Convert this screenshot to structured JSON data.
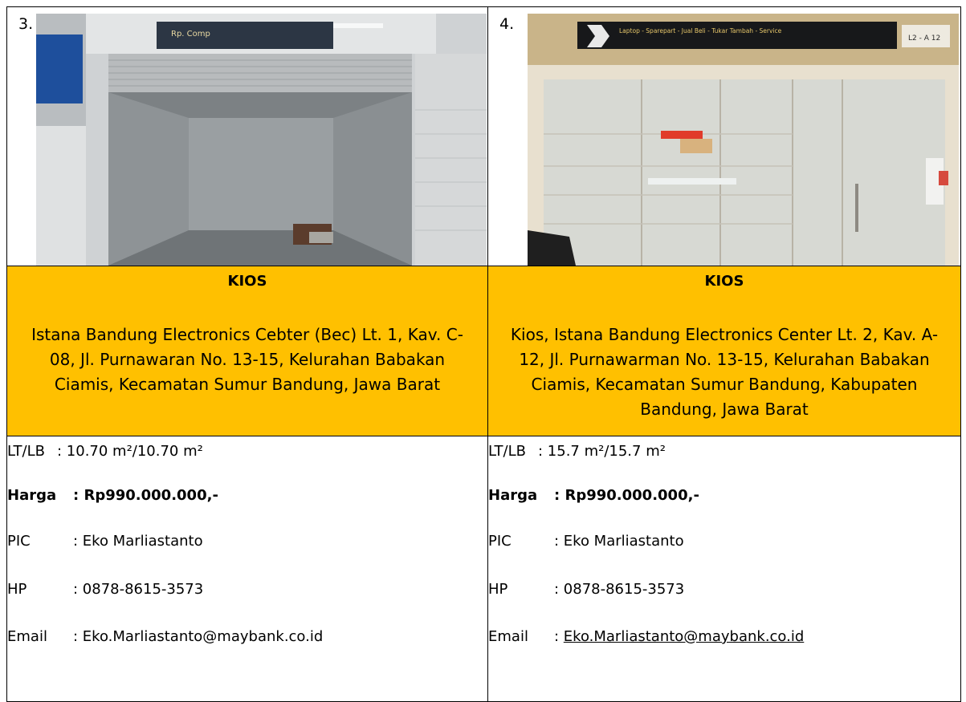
{
  "listings": [
    {
      "number": "3.",
      "category": "KIOS",
      "address": "Istana Bandung Electronics Cebter (Bec) Lt. 1, Kav. C-08, Jl. Purnawaran No. 13-15, Kelurahan Babakan Ciamis, Kecamatan Sumur Bandung, Jawa Barat",
      "sign_text": "Rp. Comp",
      "lt_lb_label": "LT/LB",
      "lt_lb_value": ": 10.70 m²/10.70 m²",
      "price_label": "Harga",
      "price_value": ": Rp990.000.000,-",
      "pic_label": "PIC",
      "pic_value": ": Eko Marliastanto",
      "hp_label": "HP",
      "hp_value": ": 0878-8615-3573",
      "email_label": "Email",
      "email_sep": ": ",
      "email_value": "Eko.Marliastanto@maybank.co.id"
    },
    {
      "number": "4.",
      "category": "KIOS",
      "address": "Kios, Istana Bandung Electronics Center Lt. 2, Kav. A-12, Jl. Purnawarman No. 13-15, Kelurahan Babakan Ciamis, Kecamatan Sumur Bandung, Kabupaten Bandung, Jawa Barat",
      "sign_text": "Laptop - Sparepart - Jual Beli - Tukar Tambah - Service",
      "sign_code": "L2 - A 12",
      "lt_lb_label": "LT/LB",
      "lt_lb_value": ": 15.7 m²/15.7 m²",
      "price_label": "Harga",
      "price_value": ": Rp990.000.000,-",
      "pic_label": "PIC",
      "pic_value": ": Eko Marliastanto",
      "hp_label": "HP",
      "hp_value": ": 0878-8615-3573",
      "email_label": "Email",
      "email_sep": ": ",
      "email_value": "Eko.Marliastanto@maybank.co.id"
    }
  ],
  "colors": {
    "heading_background": "#ffc000",
    "border": "#000000"
  }
}
